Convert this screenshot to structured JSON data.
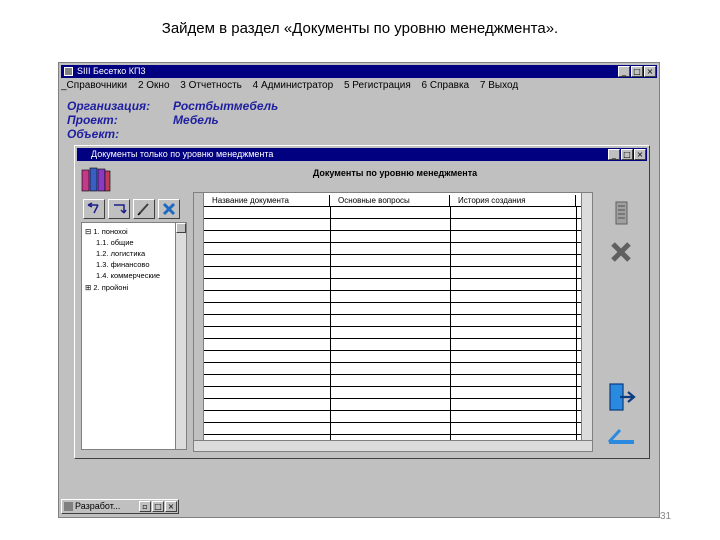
{
  "slide": {
    "title": "Зайдем в раздел «Документы по уровню менеджмента».",
    "page_number": "31"
  },
  "app": {
    "title": "SIII Бесетко КП3",
    "menu": [
      "_Справочники",
      "2 Окно",
      "3 Отчетность",
      "4 Администратор",
      "5 Регистрация",
      "6 Справка",
      "7 Выход"
    ],
    "info": [
      {
        "label": "Организация:",
        "value": "Ростбытмебель"
      },
      {
        "label": "Проект:",
        "value": "Мебель"
      },
      {
        "label": "Объект:",
        "value": ""
      }
    ]
  },
  "child_window": {
    "title": "Документы только по уровню менеджмента",
    "header": "Документы по уровню менеджмента",
    "tree": [
      {
        "text": "⊟ 1. понохоі",
        "indent": 0
      },
      {
        "text": "1.1. общие",
        "indent": 1
      },
      {
        "text": "1.2. логистика",
        "indent": 1
      },
      {
        "text": "1.3. финансово",
        "indent": 1
      },
      {
        "text": "1.4. коммерческие",
        "indent": 1
      },
      {
        "text": "⊞ 2. пройоні",
        "indent": 0
      }
    ],
    "columns": [
      "Название документа",
      "Основные вопросы",
      "История создания"
    ]
  },
  "taskbar": {
    "item_label": "Разработ..."
  },
  "colors": {
    "title_bar": "#000080",
    "info_text": "#1e1ea0",
    "window_bg": "#c0c0c0"
  }
}
